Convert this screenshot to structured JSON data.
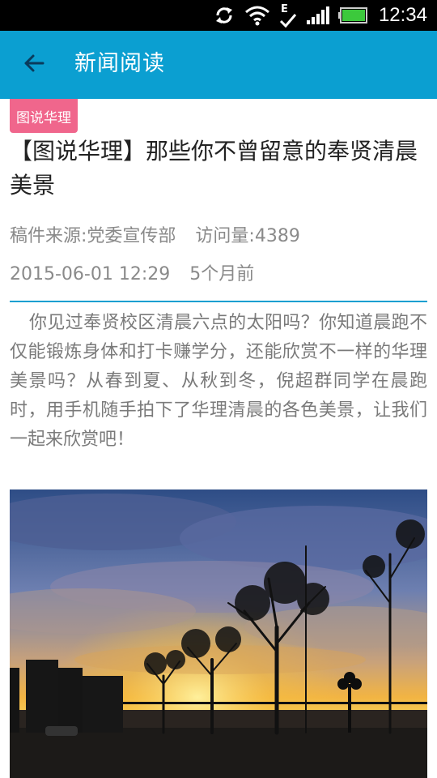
{
  "status_bar": {
    "time": "12:34",
    "network_letter": "E",
    "icons": [
      "sync-icon",
      "wifi-icon",
      "data-e-icon",
      "signal-icon",
      "battery-icon"
    ]
  },
  "app_bar": {
    "title": "新闻阅读",
    "back_icon": "arrow-left-icon",
    "background": "#0b9fd1"
  },
  "article": {
    "category_tag": "图说华理",
    "title": "【图说华理】那些你不曾留意的奉贤清晨美景",
    "source": "稿件来源:党委宣传部",
    "views": "访问量:4389",
    "date": "2015-06-01 12:29",
    "relative_time": "5个月前",
    "summary": "你见过奉贤校区清晨六点的太阳吗？你知道晨跑不仅能锻炼身体和打卡赚学分，还能欣赏不一样的华理美景吗？从春到夏、从秋到冬，倪超群同学在晨跑时，用手机随手拍下了华理清晨的各色美景，让我们一起来欣赏吧！"
  },
  "colors": {
    "accent": "#0b9fd1",
    "tag": "#f0668c"
  }
}
